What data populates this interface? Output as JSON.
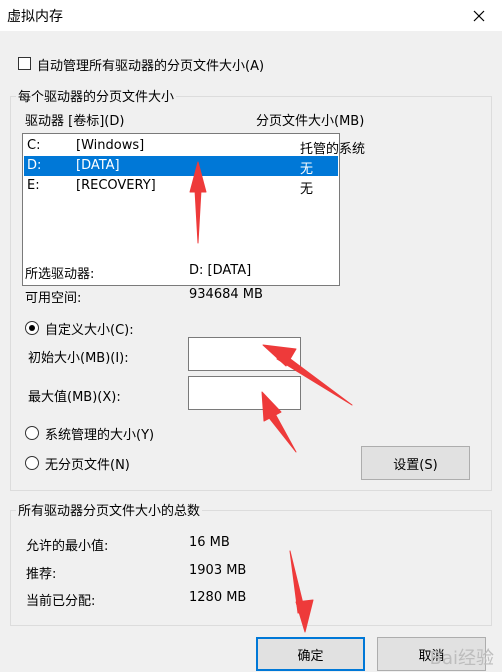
{
  "window": {
    "title": "虚拟内存"
  },
  "auto_manage": {
    "label": "自动管理所有驱动器的分页文件大小(A)",
    "checked": false
  },
  "per_drive_group": {
    "title": "每个驱动器的分页文件大小",
    "columns": {
      "drive": "驱动器 [卷标](D)",
      "size": "分页文件大小(MB)"
    },
    "rows": [
      {
        "letter": "C:",
        "label": "[Windows]",
        "size": "托管的系统"
      },
      {
        "letter": "D:",
        "label": "[DATA]",
        "size": "无",
        "selected": true
      },
      {
        "letter": "E:",
        "label": "[RECOVERY]",
        "size": "无"
      }
    ]
  },
  "selected_drive": {
    "label": "所选驱动器:",
    "value": "D:  [DATA]"
  },
  "free_space": {
    "label": "可用空间:",
    "value": "934684 MB"
  },
  "custom_size": {
    "label": "自定义大小(C):",
    "checked": true
  },
  "initial_size": {
    "label": "初始大小(MB)(I):",
    "value": ""
  },
  "max_size": {
    "label": "最大值(MB)(X):",
    "value": ""
  },
  "system_managed": {
    "label": "系统管理的大小(Y)",
    "checked": false
  },
  "no_paging": {
    "label": "无分页文件(N)",
    "checked": false
  },
  "set_button": {
    "label": "设置(S)"
  },
  "totals_group": {
    "title": "所有驱动器分页文件大小的总数",
    "min_allowed": {
      "label": "允许的最小值:",
      "value": "16 MB"
    },
    "recommended": {
      "label": "推荐:",
      "value": "1903 MB"
    },
    "allocated": {
      "label": "当前已分配:",
      "value": "1280 MB"
    }
  },
  "ok_button": {
    "label": "确定"
  },
  "cancel_button": {
    "label": "取消"
  },
  "watermark": {
    "text": "Bai经验"
  },
  "colors": {
    "selection": "#0078d7",
    "arrow": "#ee3a3a",
    "dialog_bg": "#f0f0f0"
  }
}
